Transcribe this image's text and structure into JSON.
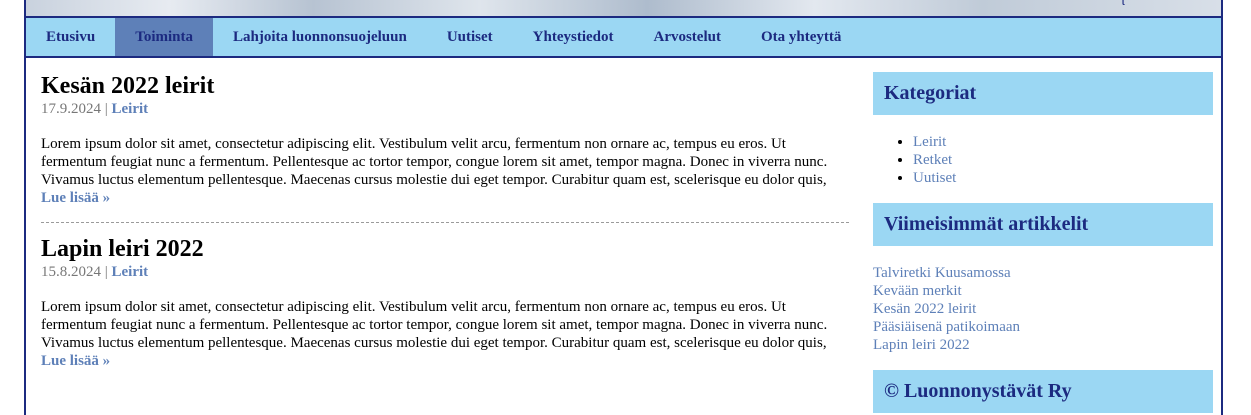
{
  "nav": {
    "items": [
      {
        "label": "Etusivu",
        "active": false
      },
      {
        "label": "Toiminta",
        "active": true
      },
      {
        "label": "Lahjoita luonnonsuojeluun",
        "active": false
      },
      {
        "label": "Uutiset",
        "active": false
      },
      {
        "label": "Yhteystiedot",
        "active": false
      },
      {
        "label": "Arvostelut",
        "active": false
      },
      {
        "label": "Ota yhteyttä",
        "active": false
      }
    ]
  },
  "posts": [
    {
      "title": "Kesän 2022 leirit",
      "date": "17.9.2024",
      "separator": "|",
      "category": "Leirit",
      "excerpt": "Lorem ipsum dolor sit amet, consectetur adipiscing elit. Vestibulum velit arcu, fermentum non ornare ac, tempus eu eros. Ut fermentum feugiat nunc a fermentum. Pellentesque ac tortor tempor, congue lorem sit amet, tempor magna. Donec in viverra nunc. Vivamus luctus elementum pellentesque. Maecenas cursus molestie dui eget tempor. Curabitur quam est, scelerisque eu dolor quis,",
      "read_more": "Lue lisää »"
    },
    {
      "title": "Lapin leiri 2022",
      "date": "15.8.2024",
      "separator": "|",
      "category": "Leirit",
      "excerpt": "Lorem ipsum dolor sit amet, consectetur adipiscing elit. Vestibulum velit arcu, fermentum non ornare ac, tempus eu eros. Ut fermentum feugiat nunc a fermentum. Pellentesque ac tortor tempor, congue lorem sit amet, tempor magna. Donec in viverra nunc. Vivamus luctus elementum pellentesque. Maecenas cursus molestie dui eget tempor. Curabitur quam est, scelerisque eu dolor quis,",
      "read_more": "Lue lisää »"
    }
  ],
  "sidebar": {
    "categories_title": "Kategoriat",
    "categories": [
      "Leirit",
      "Retket",
      "Uutiset"
    ],
    "recent_title": "Viimeisimmät artikkelit",
    "recent": [
      "Talviretki Kuusamossa",
      "Kevään merkit",
      "Kesän 2022 leirit",
      "Pääsiäisenä patikoimaan",
      "Lapin leiri 2022"
    ],
    "footer_title": "© Luonnonystävät Ry"
  },
  "colors": {
    "accent": "#9bd7f3",
    "active": "#5e80b8",
    "navy": "#1c2a80"
  }
}
